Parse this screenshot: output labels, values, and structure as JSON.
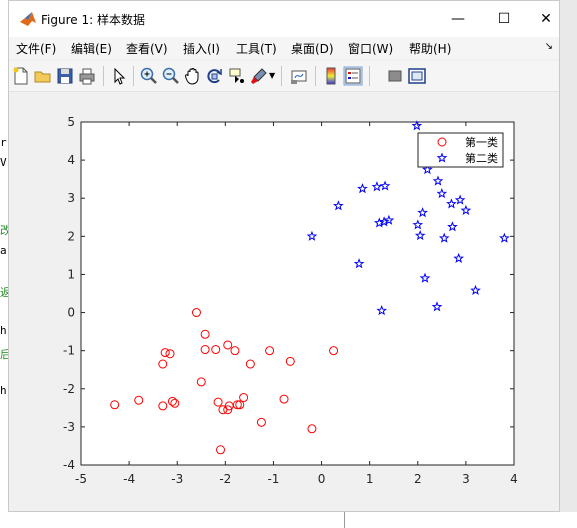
{
  "window": {
    "title": "Figure 1: 样本数据",
    "minimize": "—",
    "maximize": "☐",
    "close": "✕"
  },
  "menu": [
    "文件(F)",
    "编辑(E)",
    "查看(V)",
    "插入(I)",
    "工具(T)",
    "桌面(D)",
    "窗口(W)",
    "帮助(H)"
  ],
  "toolbar": {
    "icons": [
      "new-figure-icon",
      "open-file-icon",
      "save-icon",
      "print-icon",
      "edit-plot-icon",
      "zoom-in-icon",
      "zoom-out-icon",
      "pan-icon",
      "rotate-3d-icon",
      "data-cursor-icon",
      "brush-icon",
      "link-plot-icon",
      "colorbar-icon",
      "legend-icon",
      "hide-plot-tools-icon",
      "show-plot-tools-icon"
    ]
  },
  "background_text": [
    "r-",
    "V",
    "改",
    "a",
    "返",
    "h",
    "后",
    "h"
  ],
  "chart_data": {
    "type": "scatter",
    "xlim": [
      -5,
      4
    ],
    "ylim": [
      -4,
      5
    ],
    "xticks": [
      "-5",
      "-4",
      "-3",
      "-2",
      "-1",
      "0",
      "1",
      "2",
      "3",
      "4"
    ],
    "yticks": [
      "-4",
      "-3",
      "-2",
      "-1",
      "0",
      "1",
      "2",
      "3",
      "4",
      "5"
    ],
    "legend_position": "top-right",
    "series": [
      {
        "name": "第一类",
        "marker": "circle",
        "color": "#ff0000",
        "points": [
          [
            -4.3,
            -2.42
          ],
          [
            -3.8,
            -2.3
          ],
          [
            -3.3,
            -1.35
          ],
          [
            -3.25,
            -1.05
          ],
          [
            -3.15,
            -1.08
          ],
          [
            -3.1,
            -2.33
          ],
          [
            -3.05,
            -2.38
          ],
          [
            -3.3,
            -2.45
          ],
          [
            -2.6,
            0.0
          ],
          [
            -2.5,
            -1.82
          ],
          [
            -2.42,
            -0.57
          ],
          [
            -2.42,
            -0.97
          ],
          [
            -2.2,
            -0.97
          ],
          [
            -2.15,
            -2.35
          ],
          [
            -2.05,
            -2.55
          ],
          [
            -1.95,
            -2.55
          ],
          [
            -1.92,
            -2.45
          ],
          [
            -1.95,
            -0.85
          ],
          [
            -1.8,
            -1.0
          ],
          [
            -1.75,
            -2.42
          ],
          [
            -1.7,
            -2.42
          ],
          [
            -1.62,
            -2.23
          ],
          [
            -1.48,
            -1.35
          ],
          [
            -1.25,
            -2.88
          ],
          [
            -1.08,
            -1.0
          ],
          [
            -0.78,
            -2.27
          ],
          [
            -0.65,
            -1.28
          ],
          [
            -0.2,
            -3.05
          ],
          [
            0.25,
            -1.0
          ],
          [
            -2.1,
            -3.6
          ]
        ]
      },
      {
        "name": "第二类",
        "marker": "star",
        "color": "#0000ff",
        "points": [
          [
            -0.2,
            2.0
          ],
          [
            0.35,
            2.8
          ],
          [
            0.78,
            1.28
          ],
          [
            0.85,
            3.25
          ],
          [
            1.15,
            3.3
          ],
          [
            1.2,
            2.35
          ],
          [
            1.25,
            0.05
          ],
          [
            1.3,
            2.38
          ],
          [
            1.32,
            3.32
          ],
          [
            1.4,
            2.42
          ],
          [
            1.98,
            4.9
          ],
          [
            2.0,
            2.3
          ],
          [
            2.05,
            2.02
          ],
          [
            2.1,
            2.62
          ],
          [
            2.15,
            0.9
          ],
          [
            2.2,
            3.75
          ],
          [
            2.4,
            0.15
          ],
          [
            2.42,
            3.45
          ],
          [
            2.5,
            3.12
          ],
          [
            2.55,
            1.95
          ],
          [
            2.7,
            2.85
          ],
          [
            2.72,
            2.25
          ],
          [
            2.85,
            1.42
          ],
          [
            2.88,
            2.95
          ],
          [
            3.0,
            2.68
          ],
          [
            3.2,
            0.58
          ],
          [
            3.8,
            1.95
          ]
        ]
      }
    ]
  }
}
